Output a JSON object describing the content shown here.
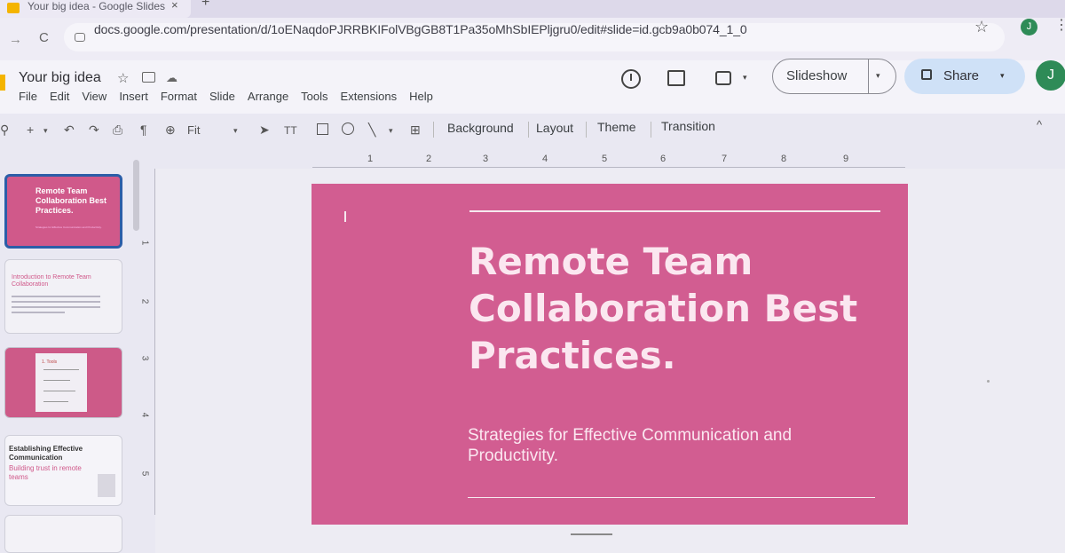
{
  "browser": {
    "tab_title": "Your big idea - Google Slides",
    "tab_close": "×",
    "new_tab": "+",
    "back": "→",
    "reload": "C",
    "url": "docs.google.com/presentation/d/1oENaqdoPJRRBKIFolVBgGB8T1Pa35oMhSbIEPljgru0/edit#slide=id.gcb9a0b074_1_0",
    "bookmark_icon": "☆",
    "profile_initial": "J",
    "menu_icon": "⋮"
  },
  "doc": {
    "title": "Your big idea",
    "star_icon": "☆",
    "cloud_icon": "☁",
    "menu": [
      "File",
      "Edit",
      "View",
      "Insert",
      "Format",
      "Slide",
      "Arrange",
      "Tools",
      "Extensions",
      "Help"
    ],
    "slideshow_label": "Slideshow",
    "share_label": "Share",
    "avatar_initial": "J",
    "caret": "▾"
  },
  "toolbar": {
    "search": "⚲",
    "new_slide": "+",
    "undo": "↶",
    "redo": "↷",
    "print": "⎙",
    "paint": "¶",
    "zoom_icon": "⊕",
    "zoom_label": "Fit",
    "select": "➤",
    "textbox": "TT",
    "line": "╲",
    "comment_add": "⊞",
    "background": "Background",
    "layout": "Layout",
    "theme": "Theme",
    "transition": "Transition",
    "collapse": "^"
  },
  "ruler": {
    "h_labels": [
      "1",
      "2",
      "3",
      "4",
      "5",
      "6",
      "7",
      "8",
      "9"
    ],
    "v_labels": [
      "1",
      "2",
      "3",
      "4",
      "5"
    ]
  },
  "filmstrip": {
    "slide1": {
      "title": "Remote Team Collaboration Best Practices.",
      "subtitle": "Strategies for Effective Communication and Productivity."
    },
    "slide2": {
      "title": "Introduction to Remote Team Collaboration"
    },
    "slide3": {
      "label": "1. Tools"
    },
    "slide4": {
      "title": "Establishing Effective Communication",
      "subtitle": "Building trust in remote teams"
    }
  },
  "slide": {
    "title": "Remote Team Collaboration Best Practices.",
    "subtitle": "Strategies for Effective Communication and Productivity.",
    "background_color": "#d25d91"
  },
  "colors": {
    "accent": "#d0598a",
    "share_bg": "#cfe1f7",
    "avatar": "#2e8b57"
  }
}
